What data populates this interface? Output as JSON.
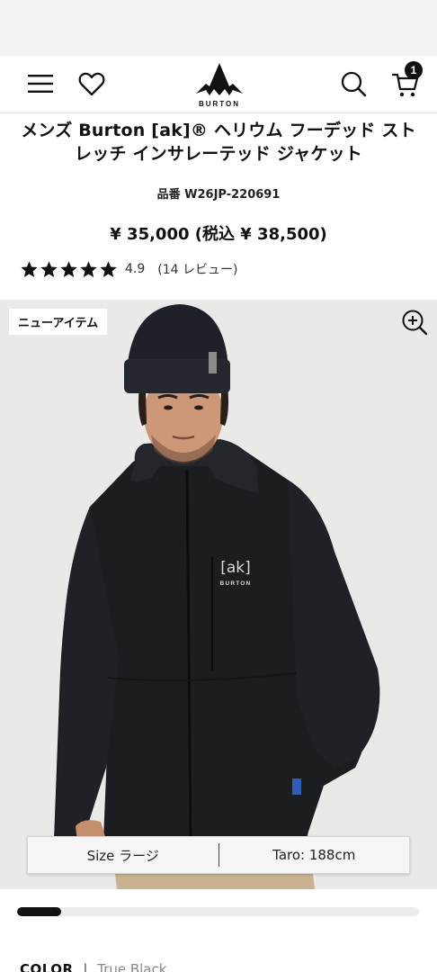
{
  "header": {
    "brand": "BURTON",
    "cart_count": "1",
    "icons": [
      "hamburger-menu-icon",
      "heart-icon",
      "burton-logo",
      "search-icon",
      "cart-icon"
    ]
  },
  "product": {
    "title": "メンズ Burton [ak]® ヘリウム フーデッド ストレッチ インサレーテッド ジャケット",
    "sku": "品番 W26JP-220691",
    "price": "¥ 35,000 (税込 ¥ 38,500)",
    "rating": {
      "value": "4.9",
      "stars": 5,
      "reviews": "(14 レビュー)"
    }
  },
  "gallery": {
    "badge": "ニューアイテム",
    "jacket_logo": "[ak]",
    "jacket_brand": "BURTON",
    "size_label": "Size ラージ",
    "model_label": "Taro: 188cm",
    "progress": 0.11
  },
  "color": {
    "label": "COLOR",
    "divider": "|",
    "value": "True Black"
  },
  "colors": {
    "background": "#e9e9e8",
    "text": "#111111",
    "jacket": "#1c1d21"
  }
}
